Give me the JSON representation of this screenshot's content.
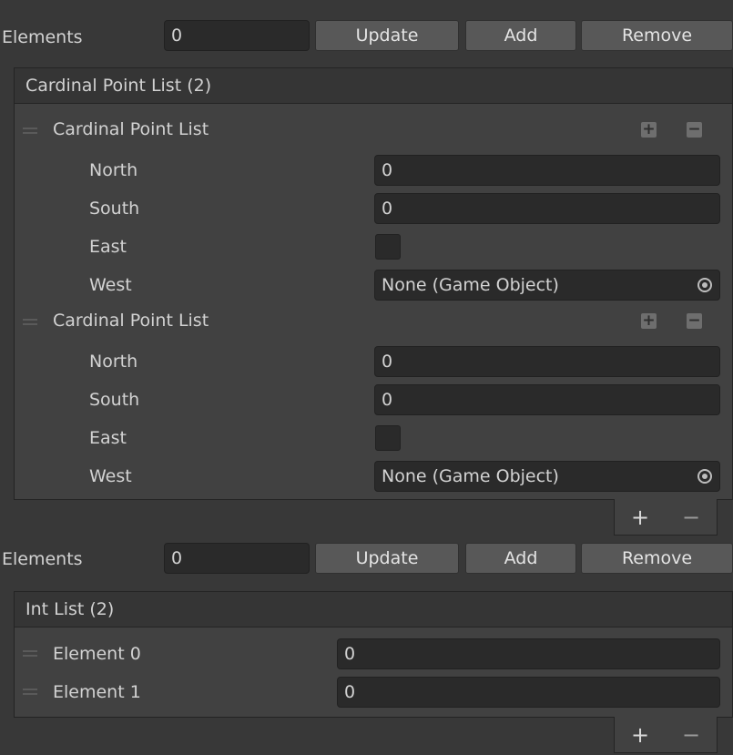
{
  "sections": [
    {
      "toolbar": {
        "elements_label": "Elements",
        "elements_value": "0",
        "update_label": "Update",
        "add_label": "Add",
        "remove_label": "Remove"
      },
      "header": "Cardinal Point List (2)",
      "items": [
        {
          "title": "Cardinal Point List",
          "north_label": "North",
          "north_value": "0",
          "south_label": "South",
          "south_value": "0",
          "east_label": "East",
          "west_label": "West",
          "west_value": "None (Game Object)"
        },
        {
          "title": "Cardinal Point List",
          "north_label": "North",
          "north_value": "0",
          "south_label": "South",
          "south_value": "0",
          "east_label": "East",
          "west_label": "West",
          "west_value": "None (Game Object)"
        }
      ],
      "footer": {
        "plus": "+",
        "minus": "−"
      }
    },
    {
      "toolbar": {
        "elements_label": "Elements",
        "elements_value": "0",
        "update_label": "Update",
        "add_label": "Add",
        "remove_label": "Remove"
      },
      "header": "Int List (2)",
      "items": [
        {
          "label": "Element 0",
          "value": "0"
        },
        {
          "label": "Element 1",
          "value": "0"
        }
      ],
      "footer": {
        "plus": "+",
        "minus": "−"
      }
    }
  ],
  "item_buttons": {
    "plus": "+",
    "minus": "−"
  }
}
